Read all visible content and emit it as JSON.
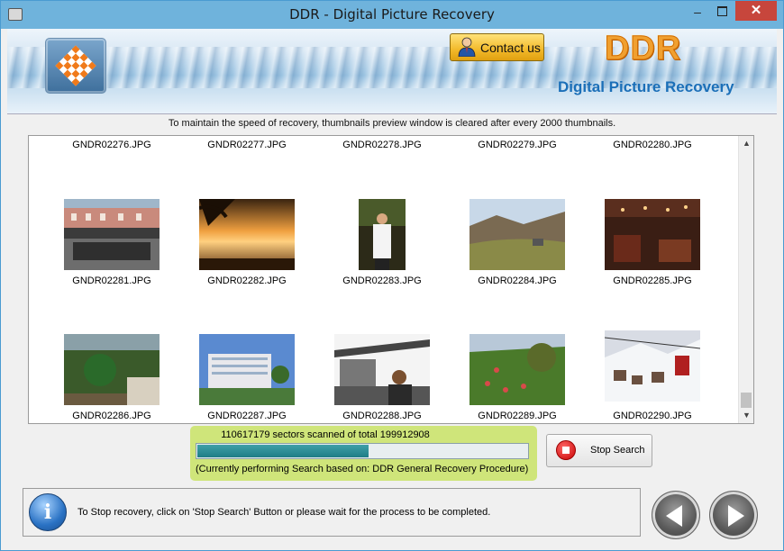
{
  "window": {
    "title": "DDR - Digital Picture Recovery",
    "minimize": "–",
    "close": "✕"
  },
  "banner": {
    "contact_label": "Contact us",
    "brand": "DDR",
    "tagline": "Digital Picture Recovery"
  },
  "notice": "To maintain the speed of recovery, thumbnails preview window is cleared after every 2000 thumbnails.",
  "thumbnails": {
    "row0": [
      "GNDR02276.JPG",
      "GNDR02277.JPG",
      "GNDR02278.JPG",
      "GNDR02279.JPG",
      "GNDR02280.JPG"
    ],
    "row1": [
      "GNDR02281.JPG",
      "GNDR02282.JPG",
      "GNDR02283.JPG",
      "GNDR02284.JPG",
      "GNDR02285.JPG"
    ],
    "row2": [
      "GNDR02286.JPG",
      "GNDR02287.JPG",
      "GNDR02288.JPG",
      "GNDR02289.JPG",
      "GNDR02290.JPG"
    ]
  },
  "progress": {
    "scan_text": "110617179 sectors scanned of total 199912908",
    "sectors_scanned": 110617179,
    "sectors_total": 199912908,
    "procedure_text": "(Currently performing Search based on:  DDR General Recovery Procedure)"
  },
  "stop_button": {
    "label": "Stop Search"
  },
  "footer": {
    "info_glyph": "i",
    "message": "To Stop recovery, click on 'Stop Search' Button or please wait for the process to be completed."
  },
  "colors": {
    "titlebar": "#6fb3dc",
    "close": "#c7463c",
    "brand": "#f0a030",
    "tagline": "#1b6fb8",
    "progress_panel": "#cfe57a",
    "progress_fill": "#1e7d86"
  }
}
